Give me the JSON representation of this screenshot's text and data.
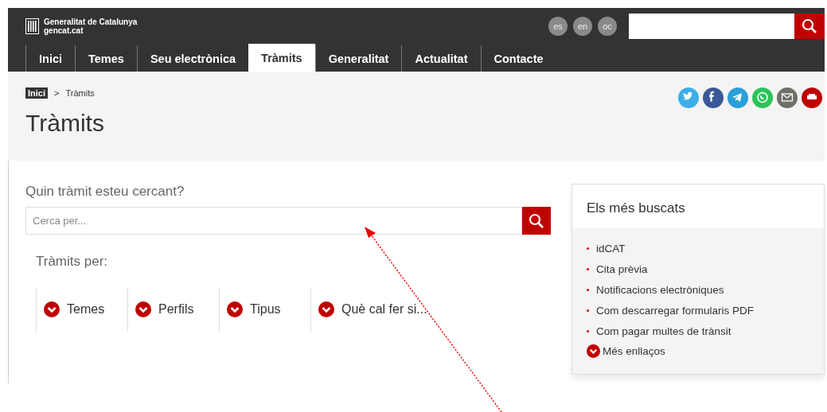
{
  "header": {
    "logo_title": "Generalitat de Catalunya",
    "logo_subtitle": "gencat.cat",
    "languages": [
      "es",
      "en",
      "oc"
    ]
  },
  "nav": [
    {
      "label": "Inici",
      "selected": false
    },
    {
      "label": "Temes",
      "selected": false
    },
    {
      "label": "Seu electrònica",
      "selected": false
    },
    {
      "label": "Tràmits",
      "selected": true
    },
    {
      "label": "Generalitat",
      "selected": false
    },
    {
      "label": "Actualitat",
      "selected": false
    },
    {
      "label": "Contacte",
      "selected": false
    }
  ],
  "breadcrumb": {
    "home": "Inici",
    "separator": ">",
    "current": "Tràmits"
  },
  "share": [
    {
      "kind": "twitter"
    },
    {
      "kind": "facebook"
    },
    {
      "kind": "telegram"
    },
    {
      "kind": "whatsapp"
    },
    {
      "kind": "email"
    },
    {
      "kind": "print"
    }
  ],
  "page_title": "Tràmits",
  "search": {
    "label": "Quin tràmit esteu cercant?",
    "placeholder": "Cerca per..."
  },
  "filters": {
    "label": "Tràmits per:",
    "items": [
      "Temes",
      "Perfils",
      "Tipus",
      "Què cal fer si..."
    ]
  },
  "popular": {
    "title": "Els més buscats",
    "links": [
      "idCAT",
      "Cita prèvia",
      "Notificacions electròniques",
      "Com descarregar formularis PDF",
      "Com pagar multes de trànsit"
    ],
    "more": "Més enllaços"
  }
}
